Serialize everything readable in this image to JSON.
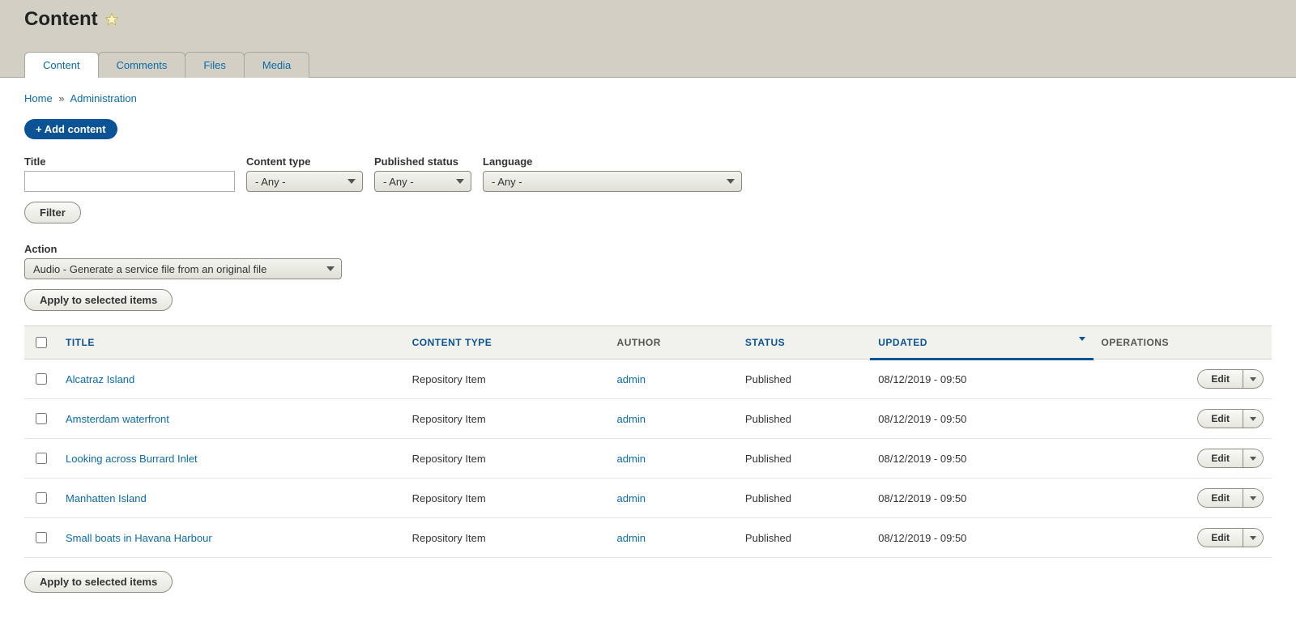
{
  "page_title": "Content",
  "tabs": [
    {
      "label": "Content",
      "active": true
    },
    {
      "label": "Comments",
      "active": false
    },
    {
      "label": "Files",
      "active": false
    },
    {
      "label": "Media",
      "active": false
    }
  ],
  "breadcrumb": {
    "home": "Home",
    "sep": "»",
    "admin": "Administration"
  },
  "add_content_label": "+ Add content",
  "filters": {
    "title_label": "Title",
    "title_value": "",
    "content_type_label": "Content type",
    "content_type_value": "- Any -",
    "published_status_label": "Published status",
    "published_status_value": "- Any -",
    "language_label": "Language",
    "language_value": "- Any -",
    "filter_button": "Filter"
  },
  "action_block": {
    "label": "Action",
    "value": "Audio - Generate a service file from an original file",
    "apply_button": "Apply to selected items"
  },
  "columns": {
    "title": "TITLE",
    "ctype": "CONTENT TYPE",
    "author": "AUTHOR",
    "status": "STATUS",
    "updated": "UPDATED",
    "ops": "OPERATIONS"
  },
  "edit_label": "Edit",
  "rows": [
    {
      "title": "Alcatraz Island",
      "ctype": "Repository Item",
      "author": "admin",
      "status": "Published",
      "updated": "08/12/2019 - 09:50"
    },
    {
      "title": "Amsterdam waterfront",
      "ctype": "Repository Item",
      "author": "admin",
      "status": "Published",
      "updated": "08/12/2019 - 09:50"
    },
    {
      "title": "Looking across Burrard Inlet",
      "ctype": "Repository Item",
      "author": "admin",
      "status": "Published",
      "updated": "08/12/2019 - 09:50"
    },
    {
      "title": "Manhatten Island",
      "ctype": "Repository Item",
      "author": "admin",
      "status": "Published",
      "updated": "08/12/2019 - 09:50"
    },
    {
      "title": "Small boats in Havana Harbour",
      "ctype": "Repository Item",
      "author": "admin",
      "status": "Published",
      "updated": "08/12/2019 - 09:50"
    }
  ]
}
